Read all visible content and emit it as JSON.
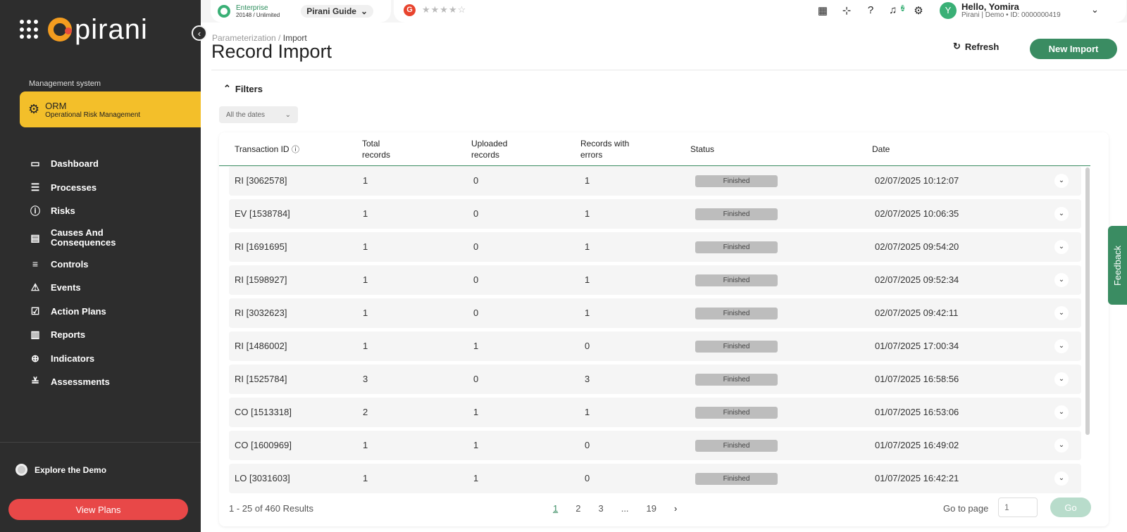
{
  "sidebar": {
    "brand": "pirani",
    "management_label": "Management system",
    "module": {
      "title": "ORM",
      "subtitle": "Operational Risk Management"
    },
    "items": [
      {
        "label": "Dashboard",
        "icon": "monitor-icon"
      },
      {
        "label": "Processes",
        "icon": "list-icon"
      },
      {
        "label": "Risks",
        "icon": "alert-circle-icon"
      },
      {
        "label": "Causes And Consequences",
        "icon": "inbox-icon"
      },
      {
        "label": "Controls",
        "icon": "sliders-icon"
      },
      {
        "label": "Events",
        "icon": "warning-icon"
      },
      {
        "label": "Action Plans",
        "icon": "checklist-icon"
      },
      {
        "label": "Reports",
        "icon": "bar-chart-icon"
      },
      {
        "label": "Indicators",
        "icon": "target-icon"
      },
      {
        "label": "Assessments",
        "icon": "list-check-icon"
      }
    ],
    "explore": "Explore the Demo",
    "view_plans": "View Plans"
  },
  "topbar": {
    "plan_title": "Enterprise",
    "plan_sub": "20148 / Unlimited",
    "guide": "Pirani Guide",
    "g_badge": "G",
    "notification_count": "2",
    "avatar_initial": "Y",
    "hello": "Hello, Yomira",
    "user_sub": "Pirani | Demo • ID: 0000000419"
  },
  "page": {
    "breadcrumb_parent": "Parameterization /",
    "breadcrumb_current": "Import",
    "title": "Record Import",
    "refresh": "Refresh",
    "new_import": "New Import",
    "filters": "Filters",
    "date_filter": "All the dates"
  },
  "table": {
    "headers": {
      "transaction_id": "Transaction ID",
      "total": "Total records",
      "uploaded": "Uploaded records",
      "errors": "Records with errors",
      "status": "Status",
      "date": "Date"
    },
    "rows": [
      {
        "id": "RI [3062578]",
        "total": "1",
        "uploaded": "0",
        "errors": "1",
        "status": "Finished",
        "date": "02/07/2025 10:12:07"
      },
      {
        "id": "EV [1538784]",
        "total": "1",
        "uploaded": "0",
        "errors": "1",
        "status": "Finished",
        "date": "02/07/2025 10:06:35"
      },
      {
        "id": "RI [1691695]",
        "total": "1",
        "uploaded": "0",
        "errors": "1",
        "status": "Finished",
        "date": "02/07/2025 09:54:20"
      },
      {
        "id": "RI [1598927]",
        "total": "1",
        "uploaded": "0",
        "errors": "1",
        "status": "Finished",
        "date": "02/07/2025 09:52:34"
      },
      {
        "id": "RI [3032623]",
        "total": "1",
        "uploaded": "0",
        "errors": "1",
        "status": "Finished",
        "date": "02/07/2025 09:42:11"
      },
      {
        "id": "RI [1486002]",
        "total": "1",
        "uploaded": "1",
        "errors": "0",
        "status": "Finished",
        "date": "01/07/2025 17:00:34"
      },
      {
        "id": "RI [1525784]",
        "total": "3",
        "uploaded": "0",
        "errors": "3",
        "status": "Finished",
        "date": "01/07/2025 16:58:56"
      },
      {
        "id": "CO [1513318]",
        "total": "2",
        "uploaded": "1",
        "errors": "1",
        "status": "Finished",
        "date": "01/07/2025 16:53:06"
      },
      {
        "id": "CO [1600969]",
        "total": "1",
        "uploaded": "1",
        "errors": "0",
        "status": "Finished",
        "date": "01/07/2025 16:49:02"
      },
      {
        "id": "LO [3031603]",
        "total": "1",
        "uploaded": "1",
        "errors": "0",
        "status": "Finished",
        "date": "01/07/2025 16:42:21"
      }
    ]
  },
  "pagination": {
    "results": "1 - 25 of 460 Results",
    "pages": [
      "1",
      "2",
      "3",
      "...",
      "19"
    ],
    "goto_label": "Go to page",
    "goto_placeholder": "1",
    "go": "Go"
  },
  "feedback": "Feedback",
  "colors": {
    "accent": "#3a8c62",
    "module": "#f3bf2a",
    "danger": "#e84848",
    "sidebar": "#2d2d2d"
  }
}
